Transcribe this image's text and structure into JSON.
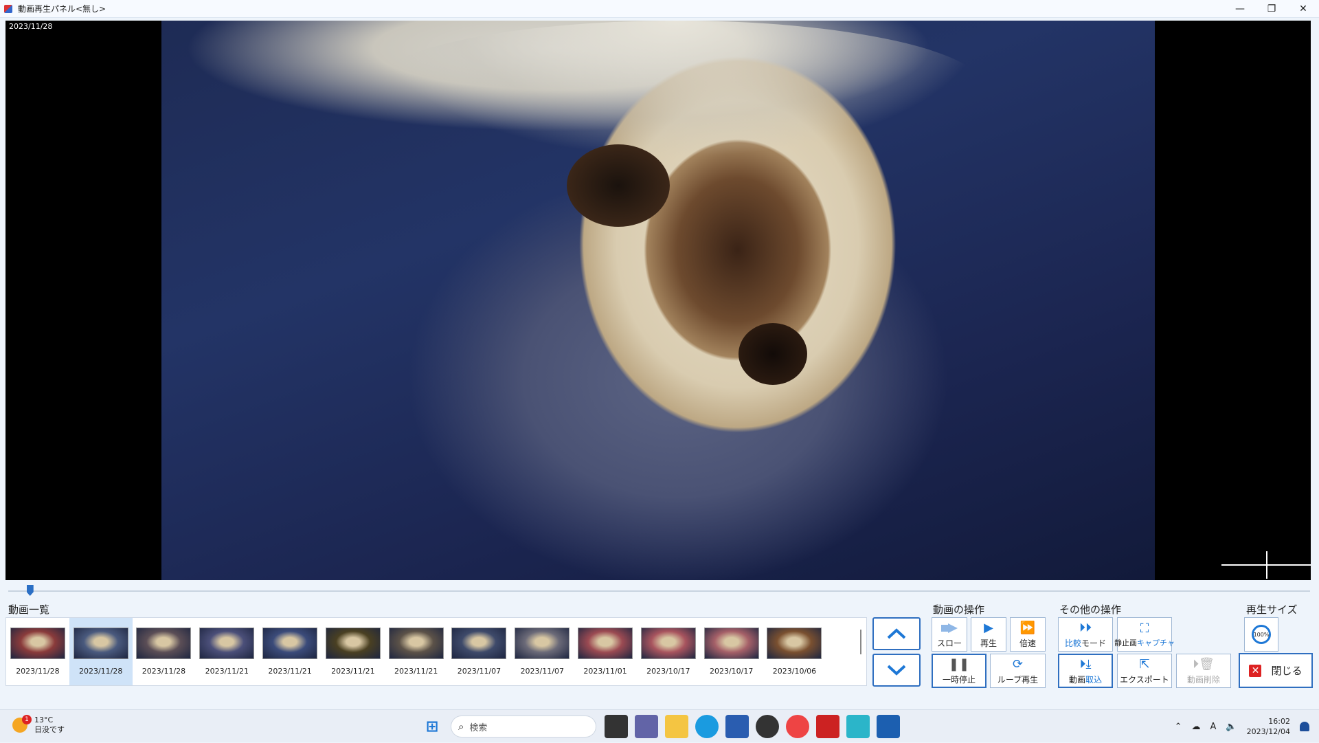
{
  "window": {
    "title": "動画再生パネル<無し>",
    "minimize": "—",
    "restore": "❐",
    "close": "✕"
  },
  "video": {
    "date": "2023/11/28",
    "seek_fraction": 0.012
  },
  "video_list": {
    "label": "動画一覧",
    "items": [
      {
        "date": "2023/11/28",
        "selected": false,
        "tint": "#8a3b3b"
      },
      {
        "date": "2023/11/28",
        "selected": true,
        "tint": "#4a5a7e"
      },
      {
        "date": "2023/11/28",
        "selected": false,
        "tint": "#5b4e56"
      },
      {
        "date": "2023/11/21",
        "selected": false,
        "tint": "#4b4f79"
      },
      {
        "date": "2023/11/21",
        "selected": false,
        "tint": "#3b4b7a"
      },
      {
        "date": "2023/11/21",
        "selected": false,
        "tint": "#4a4022"
      },
      {
        "date": "2023/11/21",
        "selected": false,
        "tint": "#5c5248"
      },
      {
        "date": "2023/11/07",
        "selected": false,
        "tint": "#3e4a6a"
      },
      {
        "date": "2023/11/07",
        "selected": false,
        "tint": "#6b6a78"
      },
      {
        "date": "2023/11/01",
        "selected": false,
        "tint": "#9b4a52"
      },
      {
        "date": "2023/10/17",
        "selected": false,
        "tint": "#a8545e"
      },
      {
        "date": "2023/10/17",
        "selected": false,
        "tint": "#a56068"
      },
      {
        "date": "2023/10/06",
        "selected": false,
        "tint": "#7a5030"
      }
    ]
  },
  "video_ops": {
    "label": "動画の操作",
    "slow": "スロー",
    "play": "再生",
    "fast": "倍速",
    "pause": "一時停止",
    "loop": "ループ再生"
  },
  "other_ops": {
    "label": "その他の操作",
    "compare_a": "比較",
    "compare_b": "モード",
    "capture_a": "静止画",
    "capture_b": "キャプチャ",
    "import_a": "動画",
    "import_b": "取込",
    "export": "エクスポート",
    "delete": "動画削除"
  },
  "play_size": {
    "label": "再生サイズ",
    "zoom": "100%"
  },
  "close_button": "閉じる",
  "taskbar": {
    "weather_temp": "13°C",
    "weather_desc": "日没です",
    "weather_badge": "1",
    "search_placeholder": "検索",
    "ime": "A",
    "time": "16:02",
    "date": "2023/12/04"
  }
}
